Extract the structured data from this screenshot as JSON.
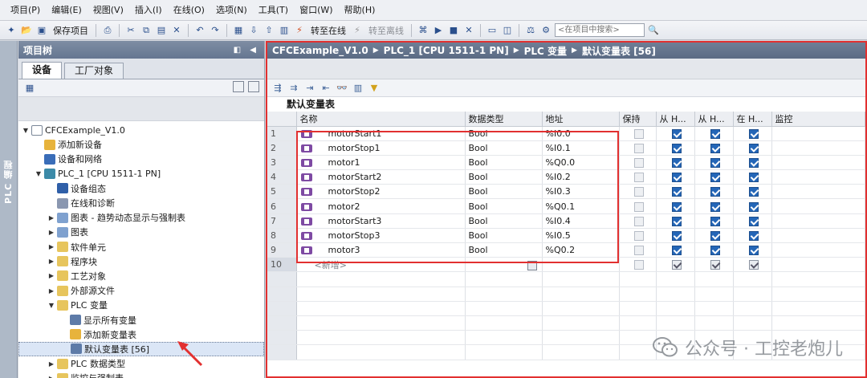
{
  "menu": [
    "项目(P)",
    "编辑(E)",
    "视图(V)",
    "插入(I)",
    "在线(O)",
    "选项(N)",
    "工具(T)",
    "窗口(W)",
    "帮助(H)"
  ],
  "toolbar": {
    "save_project": "保存项目",
    "go_online": "转至在线",
    "go_offline": "转至离线",
    "search_placeholder": "<在项目中搜索>"
  },
  "left_strip": {
    "label": "PLC 编程"
  },
  "project_tree": {
    "title": "项目树",
    "tabs": [
      "设备",
      "工厂对象"
    ],
    "nodes": [
      {
        "label": "CFCExample_V1.0",
        "level": 0,
        "arrow": "▼",
        "icon": "project-icon"
      },
      {
        "label": "添加新设备",
        "level": 1,
        "arrow": "",
        "icon": "add-device-icon"
      },
      {
        "label": "设备和网络",
        "level": 1,
        "arrow": "",
        "icon": "network-icon"
      },
      {
        "label": "PLC_1 [CPU 1511-1 PN]",
        "level": 1,
        "arrow": "▼",
        "icon": "plc-icon"
      },
      {
        "label": "设备组态",
        "level": 2,
        "arrow": "",
        "icon": "device-config-icon"
      },
      {
        "label": "在线和诊断",
        "level": 2,
        "arrow": "",
        "icon": "diagnostics-icon"
      },
      {
        "label": "图表 - 趋势动态显示与强制表",
        "level": 2,
        "arrow": "▶",
        "icon": "chart-icon"
      },
      {
        "label": "图表",
        "level": 2,
        "arrow": "▶",
        "icon": "chart-folder-icon"
      },
      {
        "label": "软件单元",
        "level": 2,
        "arrow": "▶",
        "icon": "software-unit-icon"
      },
      {
        "label": "程序块",
        "level": 2,
        "arrow": "▶",
        "icon": "program-block-icon"
      },
      {
        "label": "工艺对象",
        "level": 2,
        "arrow": "▶",
        "icon": "technology-object-icon"
      },
      {
        "label": "外部源文件",
        "level": 2,
        "arrow": "▶",
        "icon": "external-source-icon"
      },
      {
        "label": "PLC 变量",
        "level": 2,
        "arrow": "▼",
        "icon": "plc-tags-folder-icon"
      },
      {
        "label": "显示所有变量",
        "level": 3,
        "arrow": "",
        "icon": "show-all-tags-icon"
      },
      {
        "label": "添加新变量表",
        "level": 3,
        "arrow": "",
        "icon": "add-tag-table-icon"
      },
      {
        "label": "默认变量表 [56]",
        "level": 3,
        "arrow": "",
        "icon": "tag-table-icon",
        "selected": true
      },
      {
        "label": "PLC 数据类型",
        "level": 2,
        "arrow": "▶",
        "icon": "plc-data-type-icon"
      },
      {
        "label": "监控与强制表",
        "level": 2,
        "arrow": "▶",
        "icon": "watch-table-icon"
      }
    ]
  },
  "editor": {
    "breadcrumb": [
      "CFCExample_V1.0",
      "PLC_1 [CPU 1511-1 PN]",
      "PLC 变量",
      "默认变量表 [56]"
    ],
    "table_title": "默认变量表",
    "columns": [
      "",
      "名称",
      "数据类型",
      "地址",
      "保持",
      "从 H...",
      "从 H...",
      "在 H...",
      "监控"
    ],
    "rows": [
      {
        "n": "1",
        "name": "motorStart1",
        "type": "Bool",
        "addr": "%I0.0"
      },
      {
        "n": "2",
        "name": "motorStop1",
        "type": "Bool",
        "addr": "%I0.1"
      },
      {
        "n": "3",
        "name": "motor1",
        "type": "Bool",
        "addr": "%Q0.0"
      },
      {
        "n": "4",
        "name": "motorStart2",
        "type": "Bool",
        "addr": "%I0.2"
      },
      {
        "n": "5",
        "name": "motorStop2",
        "type": "Bool",
        "addr": "%I0.3"
      },
      {
        "n": "6",
        "name": "motor2",
        "type": "Bool",
        "addr": "%Q0.1"
      },
      {
        "n": "7",
        "name": "motorStart3",
        "type": "Bool",
        "addr": "%I0.4"
      },
      {
        "n": "8",
        "name": "motorStop3",
        "type": "Bool",
        "addr": "%I0.5"
      },
      {
        "n": "9",
        "name": "motor3",
        "type": "Bool",
        "addr": "%Q0.2"
      }
    ],
    "new_row": {
      "n": "10",
      "placeholder": "<新增>"
    }
  },
  "watermark": "公众号 · 工控老炮儿",
  "colors": {
    "highlight_red": "#e23030",
    "checkbox_blue": "#2466b7"
  }
}
